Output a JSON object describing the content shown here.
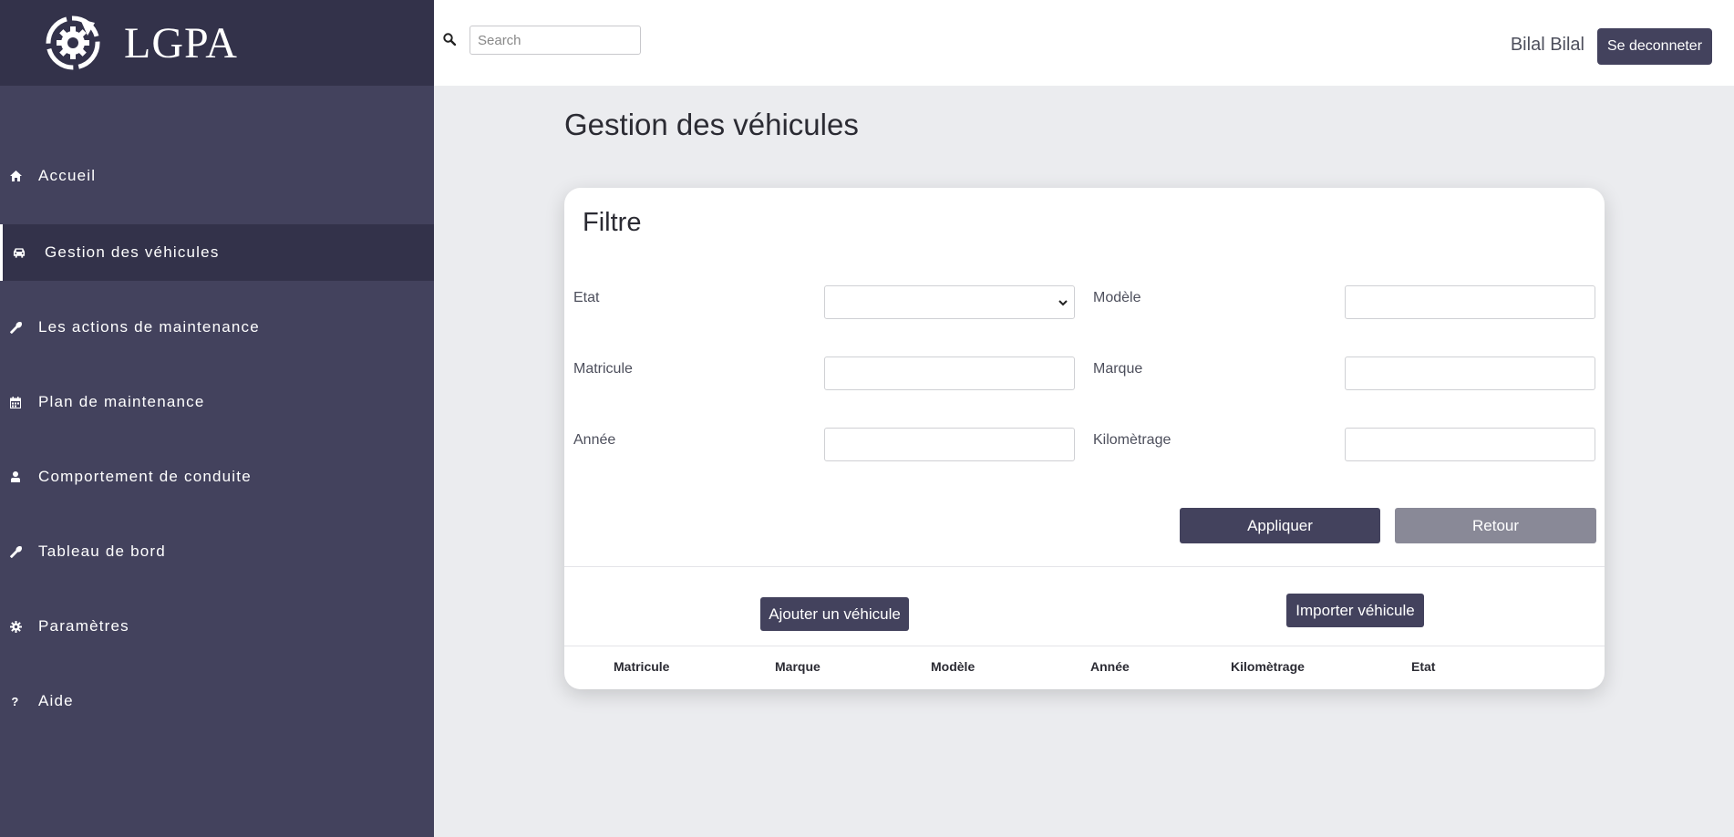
{
  "brand": {
    "name": "LGPA"
  },
  "sidebar": {
    "items": [
      {
        "label": "Accueil",
        "icon": "home-icon",
        "active": false
      },
      {
        "label": "Gestion des véhicules",
        "icon": "car-icon",
        "active": true
      },
      {
        "label": "Les actions de maintenance",
        "icon": "wrench-icon",
        "active": false
      },
      {
        "label": "Plan de maintenance",
        "icon": "calendar-icon",
        "active": false
      },
      {
        "label": "Comportement de conduite",
        "icon": "user-icon",
        "active": false
      },
      {
        "label": "Tableau de bord",
        "icon": "wrench-icon",
        "active": false
      },
      {
        "label": "Paramètres",
        "icon": "gear-icon",
        "active": false
      },
      {
        "label": "Aide",
        "icon": "question-icon",
        "active": false
      }
    ]
  },
  "topbar": {
    "search_placeholder": "Search",
    "user_name": "Bilal Bilal",
    "logout_label": "Se deconneter"
  },
  "page": {
    "title": "Gestion des véhicules"
  },
  "filter": {
    "title": "Filtre",
    "etat_label": "Etat",
    "etat_value": "",
    "modele_label": "Modèle",
    "matricule_label": "Matricule",
    "marque_label": "Marque",
    "annee_label": "Année",
    "kilometrage_label": "Kilomètrage",
    "apply_label": "Appliquer",
    "back_label": "Retour"
  },
  "actions": {
    "add_label": "Ajouter un véhicule",
    "import_label": "Importer véhicule"
  },
  "table": {
    "headers": [
      "Matricule",
      "Marque",
      "Modèle",
      "Année",
      "Kilomètrage",
      "Etat"
    ]
  },
  "colors": {
    "sidebar": "#43425d",
    "sidebar_dark": "#33324a",
    "primary_button": "#43425d",
    "secondary_button": "#898997",
    "background": "#ebecef"
  }
}
